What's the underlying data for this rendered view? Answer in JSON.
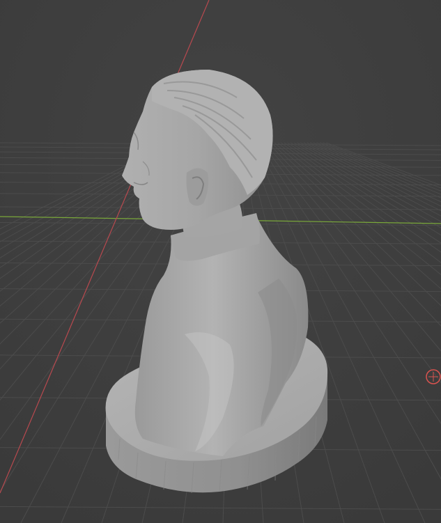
{
  "viewport": {
    "type": "3d-viewport",
    "background": "#3d3d3d",
    "grid_color": "#4a4a4a",
    "x_axis_color": "#b8494f",
    "y_axis_color": "#7aa83a",
    "model_color": "#a9a9a9",
    "origin_gizmo_color": "#d9534f"
  },
  "scene": {
    "object": "bust-sculpture",
    "icons": [
      "origin-marker-icon"
    ]
  }
}
